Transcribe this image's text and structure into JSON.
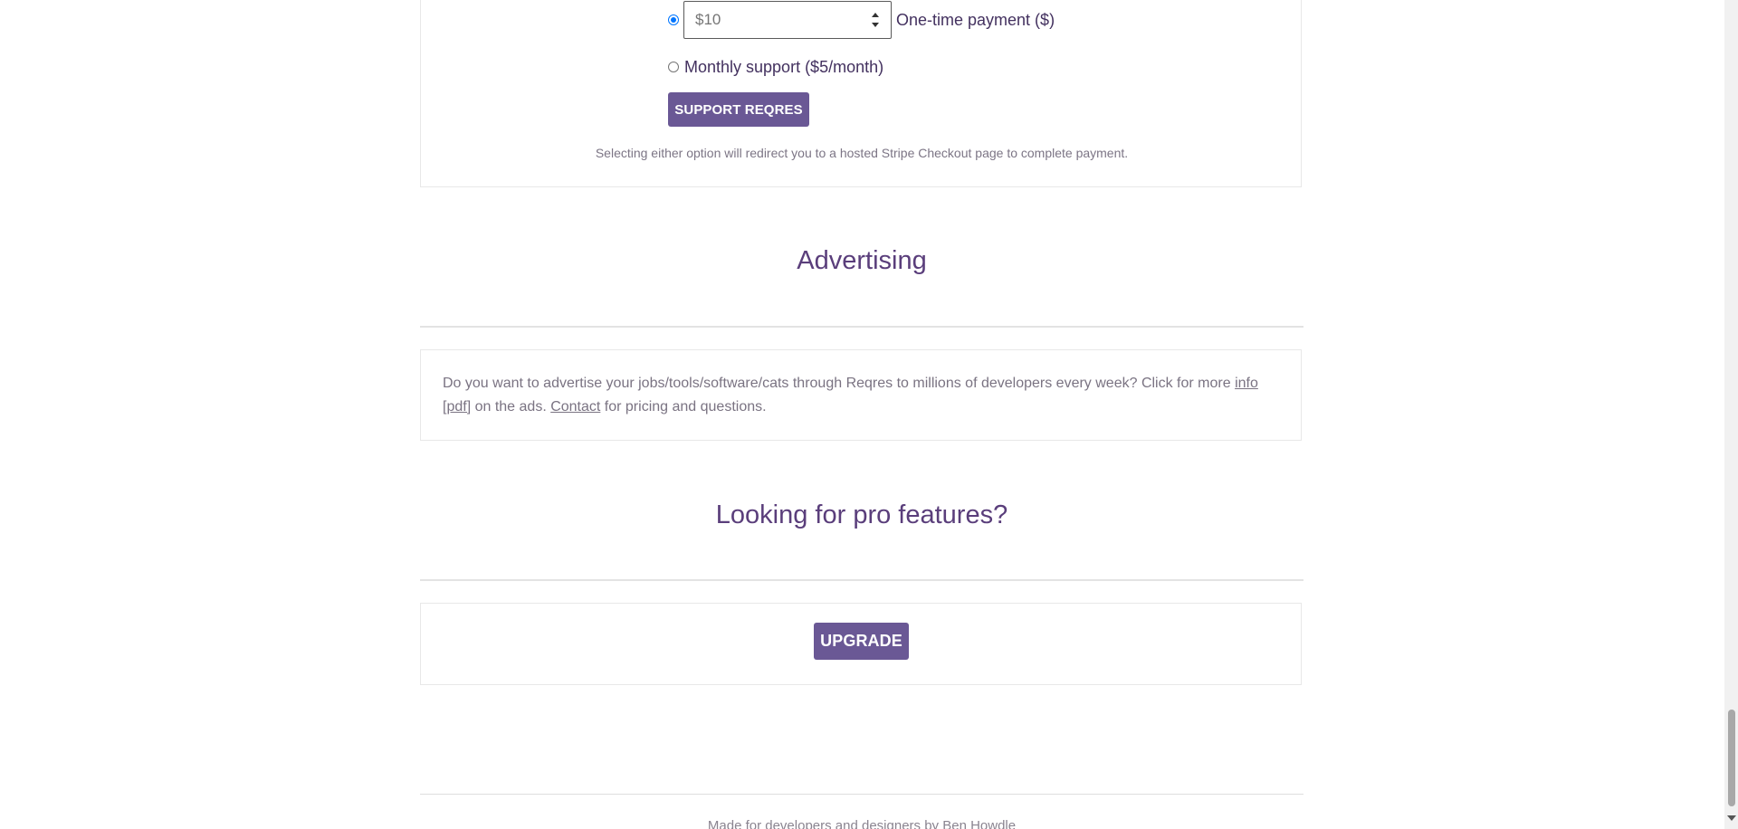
{
  "support": {
    "amount_placeholder": "$10",
    "one_time_label": "One-time payment ($)",
    "monthly_label": "Monthly support ($5/month)",
    "button_label": "SUPPORT REQRES",
    "note": "Selecting either option will redirect you to a hosted Stripe Checkout page to complete payment."
  },
  "advertising": {
    "title": "Advertising",
    "text_before": "Do you want to advertise your jobs/tools/software/cats through Reqres to millions of developers every week? Click for more ",
    "info_link": "info [pdf]",
    "text_middle": " on the ads. ",
    "contact_link": "Contact",
    "text_after": " for pricing and questions."
  },
  "pro": {
    "title": "Looking for pro features?",
    "button_label": "UPGRADE"
  },
  "footer": {
    "text": "Made for developers and designers by ",
    "author": "Ben Howdle"
  },
  "colors": {
    "accent": "#6a5895",
    "heading": "#5a3e7b",
    "radio": "#0075ff"
  }
}
